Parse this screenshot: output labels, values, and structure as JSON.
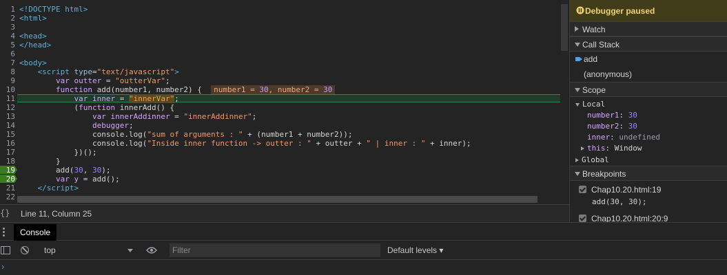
{
  "editor": {
    "lines": [
      {
        "n": "1",
        "html": "<span class=\"tag\">&lt;!DOCTYPE html&gt;</span>"
      },
      {
        "n": "2",
        "html": "<span class=\"tag\">&lt;html&gt;</span>"
      },
      {
        "n": "3",
        "html": ""
      },
      {
        "n": "4",
        "html": "<span class=\"tag\">&lt;head&gt;</span>"
      },
      {
        "n": "5",
        "html": "<span class=\"tag\">&lt;/head&gt;</span>"
      },
      {
        "n": "6",
        "html": ""
      },
      {
        "n": "7",
        "html": "<span class=\"tag\">&lt;body&gt;</span>"
      },
      {
        "n": "8",
        "html": "    <span class=\"tag\">&lt;script</span> <span class=\"attr\">type</span><span class=\"plain\">=</span><span class=\"str\">\"text/javascript\"</span><span class=\"tag\">&gt;</span>"
      },
      {
        "n": "9",
        "html": "        <span class=\"kw\">var</span> <span class=\"kw\">outter</span> = <span class=\"str\">\"outterVar\"</span>;"
      },
      {
        "n": "10",
        "html": "        <span class=\"kw\">function</span> add(number1, number2) {  <span class=\"inlinev\">number1 = <span class=\"num\">30</span>, number2 = <span class=\"num\">30</span></span>"
      },
      {
        "n": "11",
        "html": "            <span class=\"kw\">var</span> <span class=\"kw\">inner</span> = <span class=\"str\" style=\"background:#5a4a20\">\"innerVar\"</span>;"
      },
      {
        "n": "12",
        "html": "            (<span class=\"kw\">function</span> innerAdd() {"
      },
      {
        "n": "13",
        "html": "                <span class=\"kw\">var</span> <span class=\"kw\">innerAddinner</span> = <span class=\"str\">\"innerAddinner\"</span>;"
      },
      {
        "n": "14",
        "html": "                <span class=\"kw\">debugger</span>;"
      },
      {
        "n": "15",
        "html": "                console.log(<span class=\"str\">\"sum of arguments : \"</span> + (number1 + number2));"
      },
      {
        "n": "16",
        "html": "                console.log(<span class=\"str\">\"Inside inner function -&gt; outter : \"</span> + outter + <span class=\"str\">\" | inner : \"</span> + inner);"
      },
      {
        "n": "17",
        "html": "            })();"
      },
      {
        "n": "18",
        "html": "        }"
      },
      {
        "n": "19",
        "html": "        add(<span class=\"num\">30</span>, <span class=\"num\">30</span>);",
        "bp": true
      },
      {
        "n": "20",
        "html": "        <span class=\"kw\">var</span> <span class=\"kw\">y</span> = add();",
        "bp": true
      },
      {
        "n": "21",
        "html": "    <span class=\"tag\">&lt;/script&gt;</span>"
      },
      {
        "n": "22",
        "html": ""
      }
    ]
  },
  "status": {
    "braces": "{}",
    "position": "Line 11, Column 25"
  },
  "sidebar": {
    "paused": "Debugger paused",
    "watch": "Watch",
    "callstack": "Call Stack",
    "frames": [
      "add",
      "(anonymous)"
    ],
    "scope": "Scope",
    "local": "Local",
    "vars": [
      {
        "name": "number1",
        "value": "30"
      },
      {
        "name": "number2",
        "value": "30"
      },
      {
        "name": "inner",
        "value": "undefined"
      }
    ],
    "this_name": "this",
    "this_value": "Window",
    "global": "Global",
    "breakpoints": "Breakpoints",
    "bps": [
      {
        "loc": "Chap10.20.html:19",
        "code": "add(30, 30);"
      },
      {
        "loc": "Chap10.20.html:20:9",
        "code": ""
      }
    ]
  },
  "drawer": {
    "tab": "Console",
    "context": "top",
    "filter_placeholder": "Filter",
    "levels": "Default levels ▾",
    "prompt": "›"
  },
  "colors": {
    "paused_bg": "#413c19",
    "paused_text": "#f0d370",
    "highlight_line": "#1f3d2a",
    "breakpoint": "#3b7a1f"
  }
}
